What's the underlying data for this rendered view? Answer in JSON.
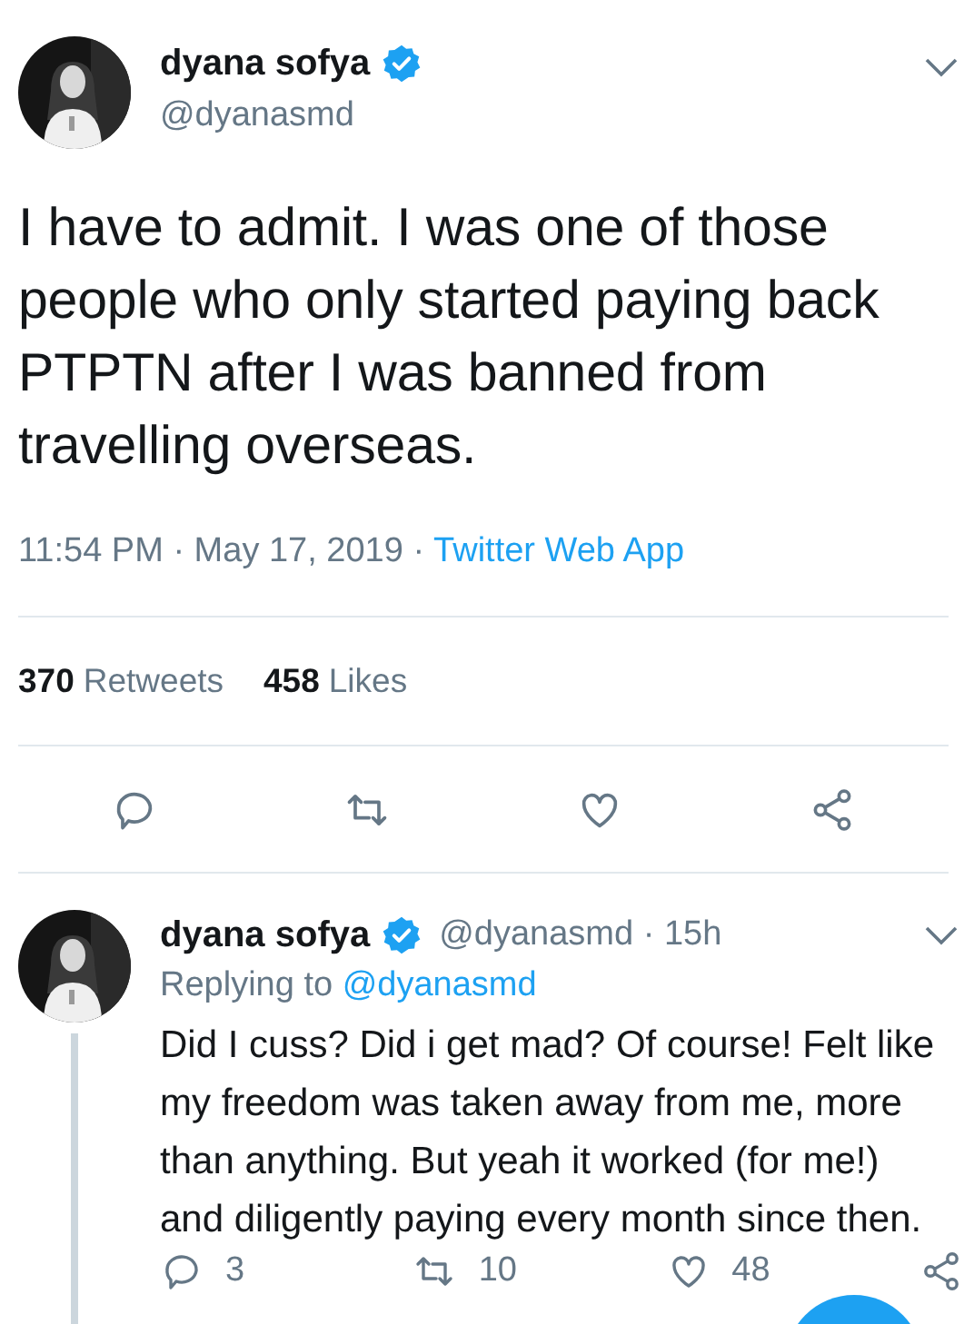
{
  "tweet": {
    "author": {
      "name": "dyana sofya",
      "verified": true,
      "handle": "@dyanasmd"
    },
    "text": "I have to admit. I was one of those people who only started paying back PTPTN after I was banned from travelling overseas.",
    "timestamp": "11:54 PM · May 17, 2019 ·",
    "source": "Twitter Web App",
    "stats": [
      {
        "count": "370",
        "label": "Retweets"
      },
      {
        "count": "458",
        "label": "Likes"
      }
    ],
    "actions": [
      {
        "kind": "reply"
      },
      {
        "kind": "retweet"
      },
      {
        "kind": "like"
      },
      {
        "kind": "share"
      }
    ]
  },
  "reply": {
    "author": {
      "name": "dyana sofya",
      "verified": true,
      "handle_time": "@dyanasmd · 15h"
    },
    "replying_label": "Replying to",
    "replying_mention": "@dyanasmd",
    "text": "Did I cuss? Did i get mad? Of course! Felt like my freedom was taken away from me, more than anything. But yeah it worked (for me!) and diligently paying every month since then.",
    "actions": [
      {
        "kind": "reply",
        "count": "3"
      },
      {
        "kind": "retweet",
        "count": "10"
      },
      {
        "kind": "like",
        "count": "48"
      },
      {
        "kind": "share"
      }
    ]
  }
}
